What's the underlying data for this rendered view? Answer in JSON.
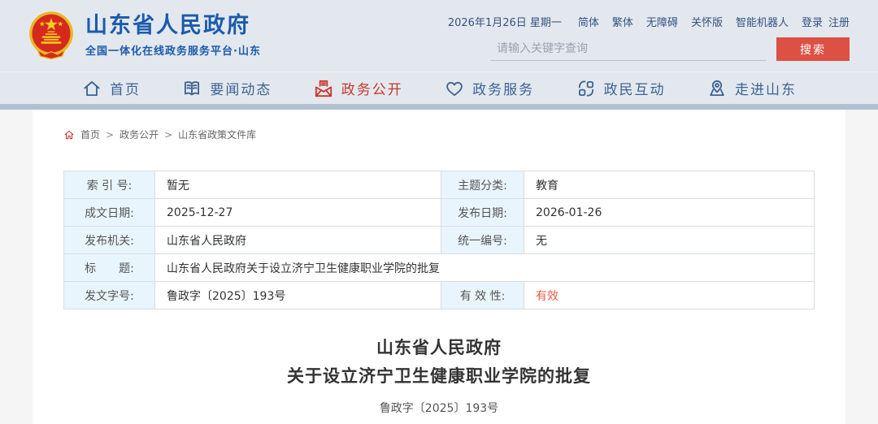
{
  "topbar": {
    "date": "2026年1月26日 星期一",
    "links": [
      "简体",
      "繁体",
      "无障碍",
      "关怀版",
      "智能机器人",
      "登录",
      "注册"
    ]
  },
  "header": {
    "title": "山东省人民政府",
    "subtitle": "全国一体化在线政务服务平台·山东",
    "search_placeholder": "请输入关键字查询",
    "search_button": "搜索"
  },
  "nav": {
    "items": [
      {
        "label": "首页",
        "icon": "home-icon",
        "active": false
      },
      {
        "label": "要闻动态",
        "icon": "book-icon",
        "active": false
      },
      {
        "label": "政务公开",
        "icon": "envelope-icon",
        "active": true
      },
      {
        "label": "政务服务",
        "icon": "heart-icon",
        "active": false
      },
      {
        "label": "政民互动",
        "icon": "interaction-icon",
        "active": false
      },
      {
        "label": "走进山东",
        "icon": "map-pin-icon",
        "active": false
      }
    ]
  },
  "breadcrumb": {
    "items": [
      "首页",
      "政务公开",
      "山东省政策文件库"
    ],
    "separator": ">"
  },
  "meta_table": {
    "rows": [
      {
        "cells": [
          {
            "label": "索 引 号:",
            "value": "暂无"
          },
          {
            "label": "主题分类:",
            "value": "教育"
          }
        ]
      },
      {
        "cells": [
          {
            "label": "成文日期:",
            "value": "2025-12-27"
          },
          {
            "label": "发布日期:",
            "value": "2026-01-26"
          }
        ]
      },
      {
        "cells": [
          {
            "label": "发布机关:",
            "value": "山东省人民政府"
          },
          {
            "label": "统一编号:",
            "value": "无"
          }
        ]
      },
      {
        "cells": [
          {
            "label": "标　　题:",
            "value": "山东省人民政府关于设立济宁卫生健康职业学院的批复"
          }
        ]
      },
      {
        "cells": [
          {
            "label": "发文字号:",
            "value": "鲁政字〔2025〕193号"
          },
          {
            "label": "有 效 性:",
            "value": "有效"
          }
        ]
      }
    ]
  },
  "document": {
    "title_line1": "山东省人民政府",
    "title_line2": "关于设立济宁卫生健康职业学院的批复",
    "doc_number": "鲁政字〔2025〕193号"
  },
  "colors": {
    "header_bg": "#e3e8ef",
    "strip": "#b2c0d2",
    "brand_blue": "#1b5bab",
    "nav_blue": "#3d6293",
    "active_red": "#c9362a",
    "search_button_red": "#dd5145",
    "valid_red": "#e65c47",
    "label_cell_bg": "#e9f5fd",
    "page_bg": "#f5f5f5"
  }
}
